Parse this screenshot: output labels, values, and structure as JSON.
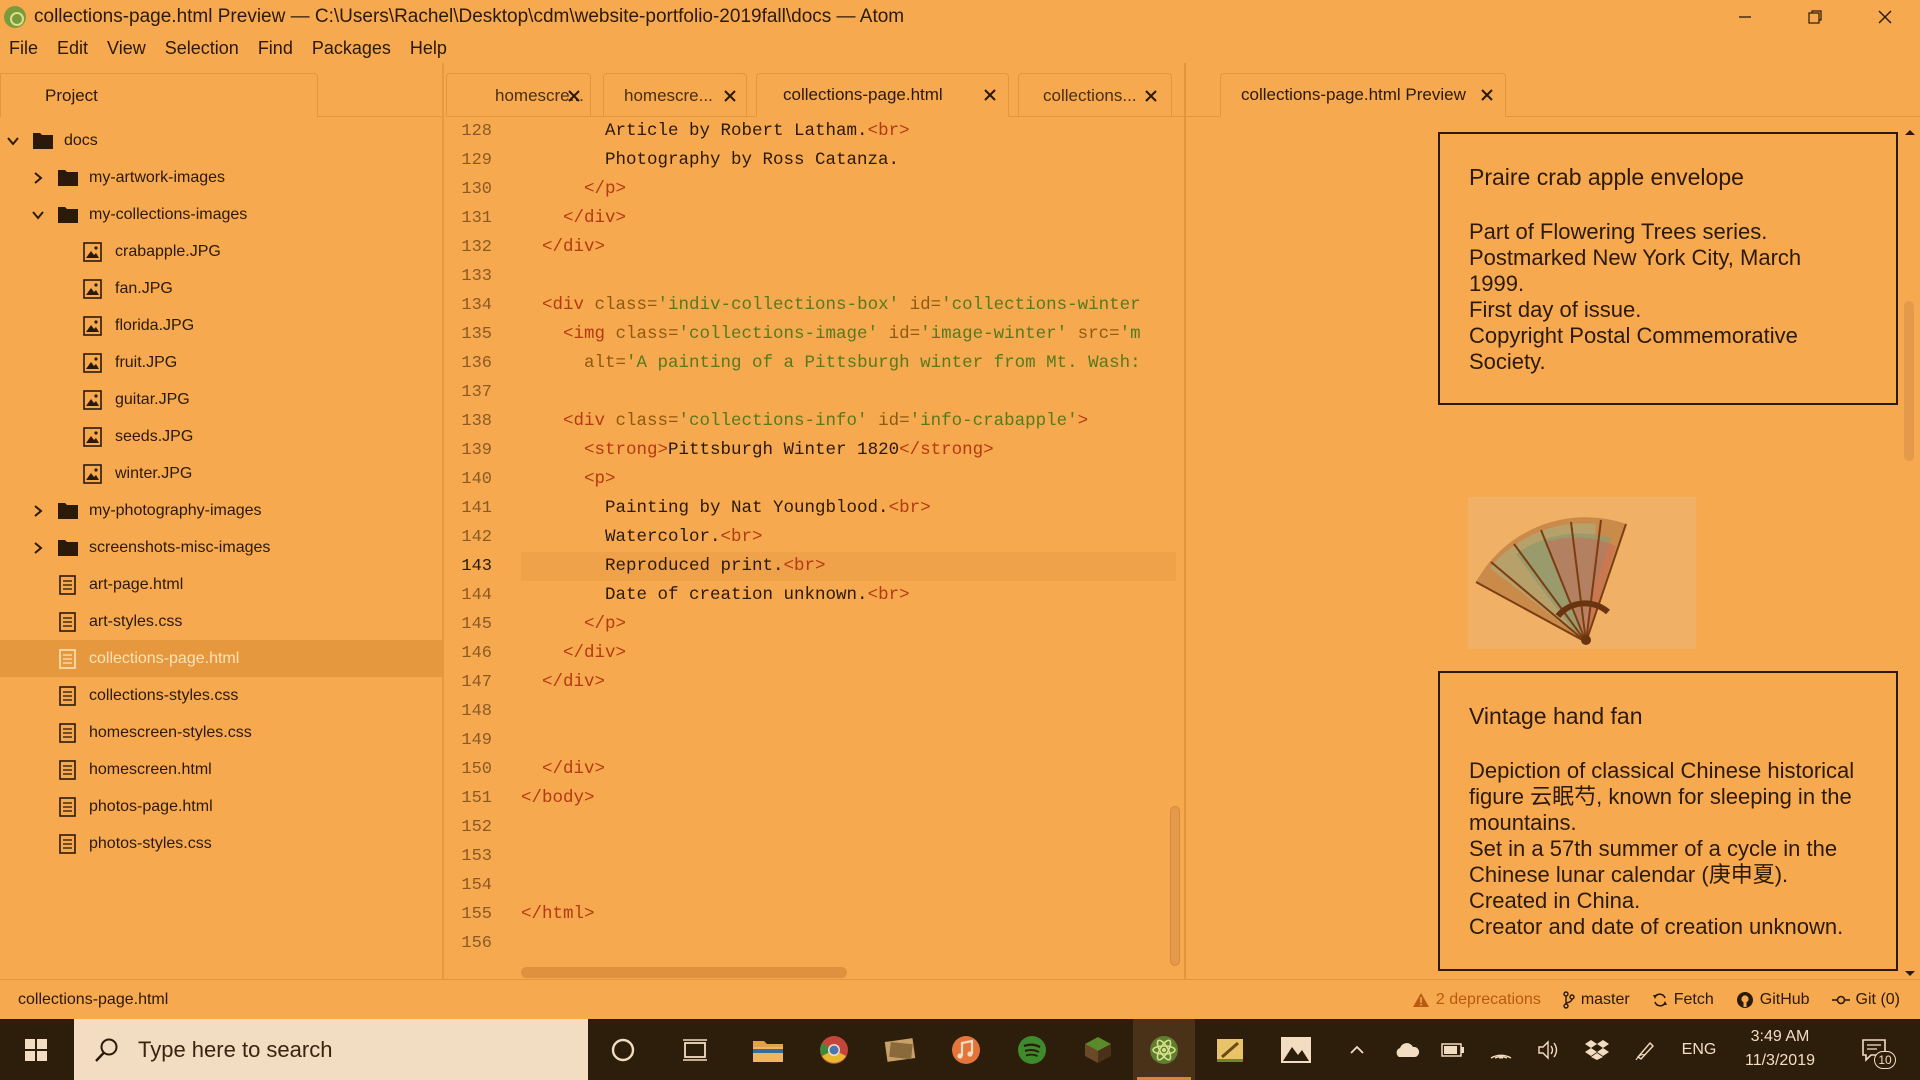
{
  "window": {
    "title": "collections-page.html Preview — C:\\Users\\Rachel\\Desktop\\cdm\\website-portfolio-2019fall\\docs — Atom"
  },
  "menu": [
    "File",
    "Edit",
    "View",
    "Selection",
    "Find",
    "Packages",
    "Help"
  ],
  "tree": {
    "tab_label": "Project",
    "items": [
      {
        "label": "docs",
        "type": "folder",
        "expanded": true
      },
      {
        "label": "my-artwork-images",
        "type": "folder",
        "expanded": false
      },
      {
        "label": "my-collections-images",
        "type": "folder",
        "expanded": true
      },
      {
        "label": "crabapple.JPG",
        "type": "image"
      },
      {
        "label": "fan.JPG",
        "type": "image"
      },
      {
        "label": "florida.JPG",
        "type": "image"
      },
      {
        "label": "fruit.JPG",
        "type": "image"
      },
      {
        "label": "guitar.JPG",
        "type": "image"
      },
      {
        "label": "seeds.JPG",
        "type": "image"
      },
      {
        "label": "winter.JPG",
        "type": "image"
      },
      {
        "label": "my-photography-images",
        "type": "folder",
        "expanded": false
      },
      {
        "label": "screenshots-misc-images",
        "type": "folder",
        "expanded": false
      },
      {
        "label": "art-page.html",
        "type": "file"
      },
      {
        "label": "art-styles.css",
        "type": "file"
      },
      {
        "label": "collections-page.html",
        "type": "file",
        "selected": true
      },
      {
        "label": "collections-styles.css",
        "type": "file"
      },
      {
        "label": "homescreen-styles.css",
        "type": "file"
      },
      {
        "label": "homescreen.html",
        "type": "file"
      },
      {
        "label": "photos-page.html",
        "type": "file"
      },
      {
        "label": "photos-styles.css",
        "type": "file"
      }
    ]
  },
  "editor": {
    "tabs": [
      {
        "label": "homescre...",
        "active": false
      },
      {
        "label": "homescre...",
        "active": false
      },
      {
        "label": "collections-page.html",
        "active": true
      },
      {
        "label": "collections...",
        "active": false
      }
    ],
    "current_line": 143,
    "lines": [
      {
        "n": 128,
        "segs": [
          [
            "tx",
            "        Article by Robert Latham."
          ],
          [
            "tg",
            "<br>"
          ]
        ]
      },
      {
        "n": 129,
        "segs": [
          [
            "tx",
            "        Photography by Ross Catanza."
          ]
        ]
      },
      {
        "n": 130,
        "segs": [
          [
            "tg",
            "      </p>"
          ]
        ]
      },
      {
        "n": 131,
        "segs": [
          [
            "tg",
            "    </div>"
          ]
        ]
      },
      {
        "n": 132,
        "segs": [
          [
            "tg",
            "  </div>"
          ]
        ]
      },
      {
        "n": 133,
        "segs": []
      },
      {
        "n": 134,
        "segs": [
          [
            "tg",
            "  <div "
          ],
          [
            "at",
            "class="
          ],
          [
            "st",
            "'indiv-collections-box'"
          ],
          [
            "tx",
            " "
          ],
          [
            "at",
            "id="
          ],
          [
            "st",
            "'collections-winter"
          ]
        ]
      },
      {
        "n": 135,
        "segs": [
          [
            "tg",
            "    <img "
          ],
          [
            "at",
            "class="
          ],
          [
            "st",
            "'collections-image'"
          ],
          [
            "tx",
            " "
          ],
          [
            "at",
            "id="
          ],
          [
            "st",
            "'image-winter'"
          ],
          [
            "tx",
            " "
          ],
          [
            "at",
            "src="
          ],
          [
            "st",
            "'m"
          ]
        ]
      },
      {
        "n": 136,
        "segs": [
          [
            "tx",
            "      "
          ],
          [
            "at",
            "alt="
          ],
          [
            "st",
            "'A painting of a Pittsburgh winter from Mt. Wash:"
          ]
        ]
      },
      {
        "n": 137,
        "segs": []
      },
      {
        "n": 138,
        "segs": [
          [
            "tg",
            "    <div "
          ],
          [
            "at",
            "class="
          ],
          [
            "st",
            "'collections-info'"
          ],
          [
            "tx",
            " "
          ],
          [
            "at",
            "id="
          ],
          [
            "st",
            "'info-crabapple'"
          ],
          [
            "tg",
            ">"
          ]
        ]
      },
      {
        "n": 139,
        "segs": [
          [
            "tg",
            "      <strong>"
          ],
          [
            "tx",
            "Pittsburgh Winter 1820"
          ],
          [
            "tg",
            "</strong>"
          ]
        ]
      },
      {
        "n": 140,
        "segs": [
          [
            "tg",
            "      <p>"
          ]
        ]
      },
      {
        "n": 141,
        "segs": [
          [
            "tx",
            "        Painting by Nat Youngblood."
          ],
          [
            "tg",
            "<br>"
          ]
        ]
      },
      {
        "n": 142,
        "segs": [
          [
            "tx",
            "        Watercolor."
          ],
          [
            "tg",
            "<br>"
          ]
        ]
      },
      {
        "n": 143,
        "segs": [
          [
            "tx",
            "        Reproduced print."
          ],
          [
            "tg",
            "<br>"
          ]
        ]
      },
      {
        "n": 144,
        "segs": [
          [
            "tx",
            "        Date of creation unknown."
          ],
          [
            "tg",
            "<br>"
          ]
        ]
      },
      {
        "n": 145,
        "segs": [
          [
            "tg",
            "      </p>"
          ]
        ]
      },
      {
        "n": 146,
        "segs": [
          [
            "tg",
            "    </div>"
          ]
        ]
      },
      {
        "n": 147,
        "segs": [
          [
            "tg",
            "  </div>"
          ]
        ]
      },
      {
        "n": 148,
        "segs": []
      },
      {
        "n": 149,
        "segs": []
      },
      {
        "n": 150,
        "segs": [
          [
            "tg",
            "  </div>"
          ]
        ]
      },
      {
        "n": 151,
        "segs": [
          [
            "tg",
            "</body>"
          ]
        ]
      },
      {
        "n": 152,
        "segs": []
      },
      {
        "n": 153,
        "segs": []
      },
      {
        "n": 154,
        "segs": []
      },
      {
        "n": 155,
        "segs": [
          [
            "tg",
            "</html>"
          ]
        ]
      },
      {
        "n": 156,
        "segs": []
      }
    ]
  },
  "preview": {
    "tab_label": "collections-page.html Preview",
    "card1": {
      "title": "Praire crab apple envelope",
      "lines": [
        "Part of Flowering Trees series.",
        "Postmarked New York City, March",
        "1999.",
        "First day of issue.",
        "Copyright Postal Commemorative",
        "Society."
      ]
    },
    "card2": {
      "title": "Vintage hand fan",
      "lines": [
        "Depiction of classical Chinese historical",
        "figure 云眠芍, known for sleeping in the",
        "mountains.",
        "Set in a 57th summer of a cycle in the",
        "Chinese lunar calendar (庚申夏).",
        "Created in China.",
        "Creator and date of creation unknown."
      ]
    }
  },
  "status": {
    "file": "collections-page.html",
    "deprecations": "2 deprecations",
    "branch": "master",
    "fetch": "Fetch",
    "github": "GitHub",
    "git": "Git (0)"
  },
  "taskbar": {
    "search_placeholder": "Type here to search",
    "language": "ENG",
    "time": "3:49 AM",
    "date": "11/3/2019",
    "notifications": "10"
  },
  "colors": {
    "background": "#f7a94f",
    "taskbar": "#2d1d0b",
    "tag": "#b33a12",
    "attribute": "#8e5a12",
    "string": "#557a1e",
    "warning": "#b85a10"
  }
}
